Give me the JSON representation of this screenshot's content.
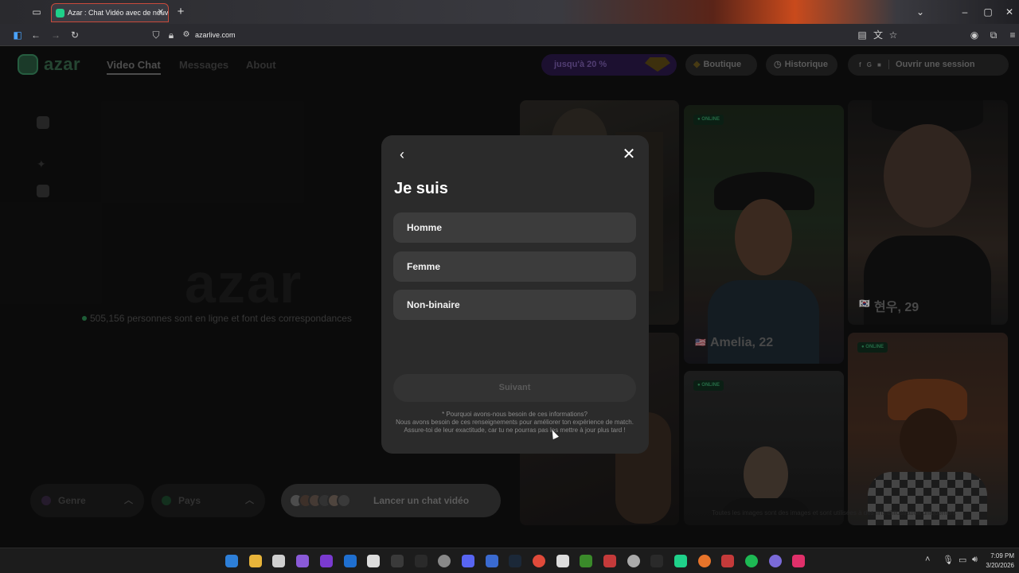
{
  "browser": {
    "tab_title": "Azar : Chat Vidéo avec de nouv",
    "tab_close": "✕",
    "new_tab": "+",
    "url": "azarlive.com"
  },
  "site": {
    "logo_text": "azar",
    "nav": {
      "video_chat": "Video Chat",
      "messages": "Messages",
      "about": "About"
    },
    "promo_label": "jusqu'à 20 %",
    "shop_label": "Boutique",
    "history_label": "Historique",
    "login_label": "Ouvrir une session",
    "login_providers": [
      "",
      "f",
      "G",
      ""
    ],
    "big_logo": "azar",
    "online_text": "505,156 personnes sont en ligne et font des correspondances",
    "genre_label": "Genre",
    "pays_label": "Pays",
    "launch_label": "Lancer un chat vidéo",
    "profiles": [
      {
        "name": "Amelia, 22",
        "badge": "● ONLINE",
        "flag": "🇺🇸"
      },
      {
        "name": "현우, 29",
        "flag": "🇰🇷"
      },
      {
        "badge": "● ONLINE"
      },
      {
        "badge": "● ONLINE"
      }
    ],
    "disclaimer": "Toutes les images sont des images et sont utilisées à des fins d'illustration uniquement"
  },
  "modal": {
    "title": "Je suis",
    "options": [
      "Homme",
      "Femme",
      "Non-binaire"
    ],
    "next_label": "Suivant",
    "why_title": "* Pourquoi avons-nous besoin de ces informations?",
    "why_body": "Nous avons besoin de ces renseignements pour améliorer ton expérience de match. Assure-toi de leur exactitude, car tu ne pourras pas les mettre à jour plus tard !"
  },
  "taskbar": {
    "time": "7:09 PM",
    "date": "3/20/2026"
  },
  "colors": {
    "accent_green": "#2f8f55",
    "modal_bg": "#2b2b2b",
    "option_bg": "#3c3c3c"
  }
}
